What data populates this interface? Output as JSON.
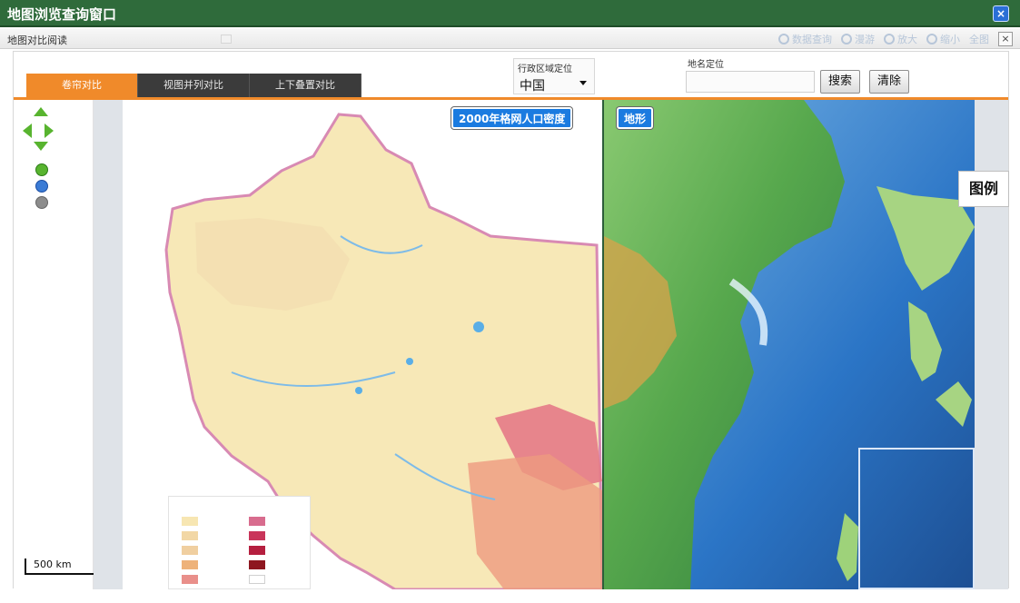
{
  "window": {
    "title": "地图浏览查询窗口",
    "subtitle": "地图对比阅读",
    "close_glyph": "×"
  },
  "toolbar": {
    "items": [
      {
        "label": "数据查询",
        "icon": "printer-icon"
      },
      {
        "label": "漫游",
        "icon": "hand-icon"
      },
      {
        "label": "放大",
        "icon": "zoom-in-icon"
      },
      {
        "label": "缩小",
        "icon": "zoom-out-icon"
      },
      {
        "label": "全图",
        "icon": "full-extent-icon"
      }
    ],
    "close_glyph": "×"
  },
  "tabs": [
    {
      "label": "卷帘对比",
      "active": true
    },
    {
      "label": "视图并列对比",
      "active": false
    },
    {
      "label": "上下叠置对比",
      "active": false
    }
  ],
  "admin_location": {
    "label": "行政区域定位",
    "value": "中国"
  },
  "place_search": {
    "label": "地名定位",
    "placeholder": "",
    "search_button": "搜索",
    "clear_button": "清除"
  },
  "maps": {
    "left_title": "2000年格网人口密度",
    "right_title": "地形"
  },
  "legend": {
    "tab_label": "图例"
  },
  "scale_bar": {
    "label": "500 km"
  },
  "colors": {
    "title_bar": "#2f6b3b",
    "tab_active": "#f08a2a",
    "tab_inactive": "#3b3b3b",
    "map_label_bg": "#1b7be0"
  }
}
